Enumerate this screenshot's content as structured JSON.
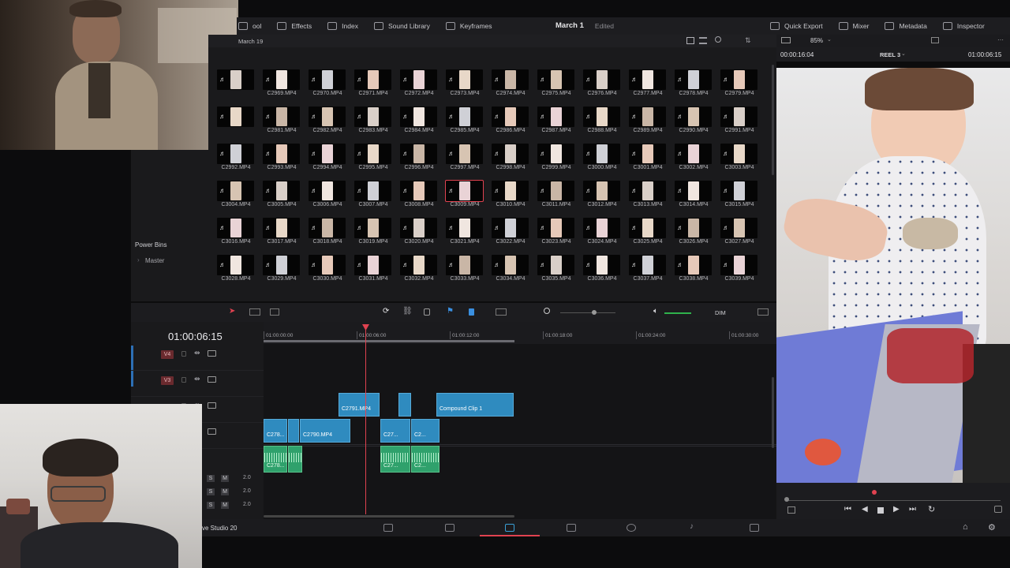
{
  "topbar": {
    "left_items": [
      {
        "label": "ool",
        "icon": "media-pool-icon"
      },
      {
        "label": "Effects",
        "icon": "effects-icon"
      },
      {
        "label": "Index",
        "icon": "index-icon"
      },
      {
        "label": "Sound Library",
        "icon": "sound-library-icon"
      },
      {
        "label": "Keyframes",
        "icon": "keyframes-icon"
      }
    ],
    "project_title": "March 1",
    "project_status": "Edited",
    "right_items": [
      {
        "label": "Quick Export",
        "icon": "quick-export-icon"
      },
      {
        "label": "Mixer",
        "icon": "mixer-icon"
      },
      {
        "label": "Metadata",
        "icon": "metadata-icon"
      },
      {
        "label": "Inspector",
        "icon": "inspector-icon"
      }
    ]
  },
  "media_pool": {
    "bin_name": "March 19",
    "selected_clip": "C3009.MP4",
    "rows": [
      [
        "",
        "C2969.MP4",
        "C2970.MP4",
        "C2971.MP4",
        "C2972.MP4",
        "C2973.MP4",
        "C2974.MP4",
        "C2975.MP4",
        "C2976.MP4",
        "C2977.MP4",
        "C2978.MP4",
        "C2979.MP4"
      ],
      [
        "",
        "C2981.MP4",
        "C2982.MP4",
        "C2983.MP4",
        "C2984.MP4",
        "C2985.MP4",
        "C2986.MP4",
        "C2987.MP4",
        "C2988.MP4",
        "C2989.MP4",
        "C2990.MP4",
        "C2991.MP4"
      ],
      [
        "C2992.MP4",
        "C2993.MP4",
        "C2994.MP4",
        "C2995.MP4",
        "C2996.MP4",
        "C2997.MP4",
        "C2998.MP4",
        "C2999.MP4",
        "C3000.MP4",
        "C3001.MP4",
        "C3002.MP4",
        "C3003.MP4"
      ],
      [
        "C3004.MP4",
        "C3005.MP4",
        "C3006.MP4",
        "C3007.MP4",
        "C3008.MP4",
        "C3009.MP4",
        "C3010.MP4",
        "C3011.MP4",
        "C3012.MP4",
        "C3013.MP4",
        "C3014.MP4",
        "C3015.MP4"
      ],
      [
        "C3016.MP4",
        "C3017.MP4",
        "C3018.MP4",
        "C3019.MP4",
        "C3020.MP4",
        "C3021.MP4",
        "C3022.MP4",
        "C3023.MP4",
        "C3024.MP4",
        "C3025.MP4",
        "C3026.MP4",
        "C3027.MP4"
      ],
      [
        "C3028.MP4",
        "C3029.MP4",
        "C3030.MP4",
        "C3031.MP4",
        "C3032.MP4",
        "C3033.MP4",
        "C3034.MP4",
        "C3035.MP4",
        "C3036.MP4",
        "C3037.MP4",
        "C3038.MP4",
        "C3039.MP4"
      ]
    ]
  },
  "left_panel": {
    "power_bins_label": "Power Bins",
    "master_label": "Master"
  },
  "viewer": {
    "zoom": "85%",
    "source_timecode": "00:00:16:04",
    "reel": "REEL 3",
    "record_timecode": "01:00:06:15"
  },
  "timeline": {
    "timecode": "01:00:06:15",
    "ruler": [
      "01:00:00:00",
      "01:00:06:00",
      "01:00:12:00",
      "01:00:18:00",
      "01:00:24:00",
      "01:00:30:00"
    ],
    "dim_label": "DIM",
    "tracks": [
      {
        "badge": "V4"
      },
      {
        "badge": "V3"
      },
      {
        "badge": ""
      },
      {
        "badge": ""
      }
    ],
    "video_clips_v2": [
      {
        "label": "C2791.MP4"
      },
      {
        "label": ""
      },
      {
        "label": "Compound Clip 1"
      }
    ],
    "video_clips_v1": [
      {
        "label": "C278..."
      },
      {
        "label": ""
      },
      {
        "label": "C2790.MP4"
      },
      {
        "label": "C27..."
      },
      {
        "label": "C2..."
      }
    ],
    "audio_clips": [
      {
        "label": "C278..."
      },
      {
        "label": ""
      },
      {
        "label": "C27..."
      },
      {
        "label": "C2..."
      }
    ],
    "audio_rows": [
      {
        "solo": "S",
        "mute": "M",
        "level": "2.0"
      },
      {
        "solo": "S",
        "mute": "M",
        "level": "2.0"
      },
      {
        "solo": "S",
        "mute": "M",
        "level": "2.0"
      }
    ]
  },
  "bottom_bar": {
    "app_label": "ve Studio 20"
  },
  "colors": {
    "accent_red": "#e04250",
    "clip_blue": "#2f8bbf",
    "clip_green": "#2fa16c"
  }
}
